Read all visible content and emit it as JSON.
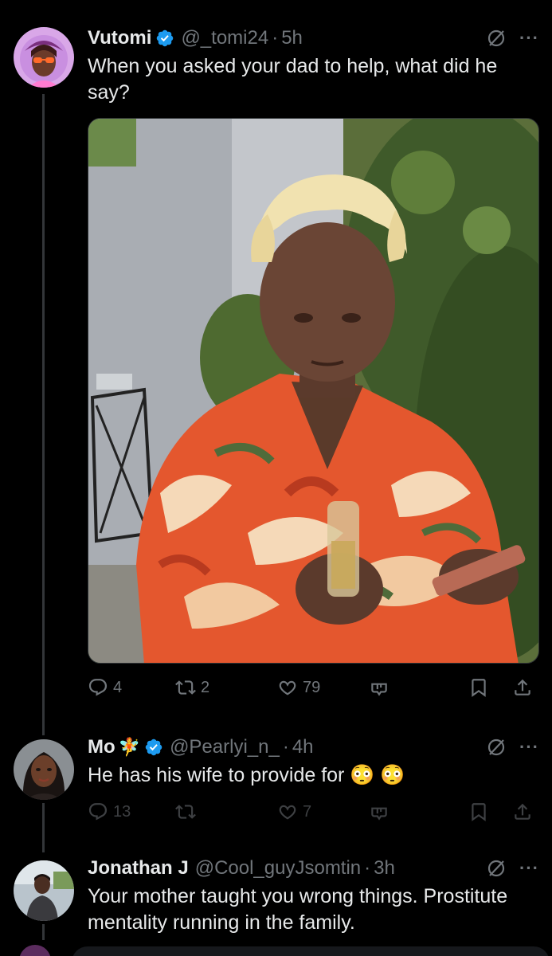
{
  "tweets": [
    {
      "name": "Vutomi",
      "badge_emoji": "",
      "handle": "@_tomi24",
      "time": "5h",
      "text": "When you asked your dad to help, what did he say?",
      "media": true,
      "replies": "4",
      "reposts": "2",
      "likes": "79"
    },
    {
      "name": "Mo",
      "badge_emoji": "🧚",
      "handle": "@Pearlyi_n_",
      "time": "4h",
      "text": "He has his wife to provide for 😳 😳",
      "media": false,
      "replies": "13",
      "reposts": "",
      "likes": "7"
    },
    {
      "name": "Jonathan J",
      "badge_emoji": "",
      "handle": "@Cool_guyJsomtin",
      "time": "3h",
      "text": "Your mother taught you wrong things. Prostitute mentality running in the family.",
      "media": false
    }
  ],
  "separator": "·",
  "more_icon": "···",
  "colors": {
    "background": "#000000",
    "text": "#e7e9ea",
    "muted": "#71767b",
    "verified": "#1d9bf0",
    "thread_line": "#333639"
  },
  "icons": [
    "verified-badge-icon",
    "grok-icon",
    "more-icon",
    "reply-icon",
    "repost-icon",
    "like-icon",
    "grok-analyze-icon",
    "bookmark-icon",
    "share-icon"
  ]
}
